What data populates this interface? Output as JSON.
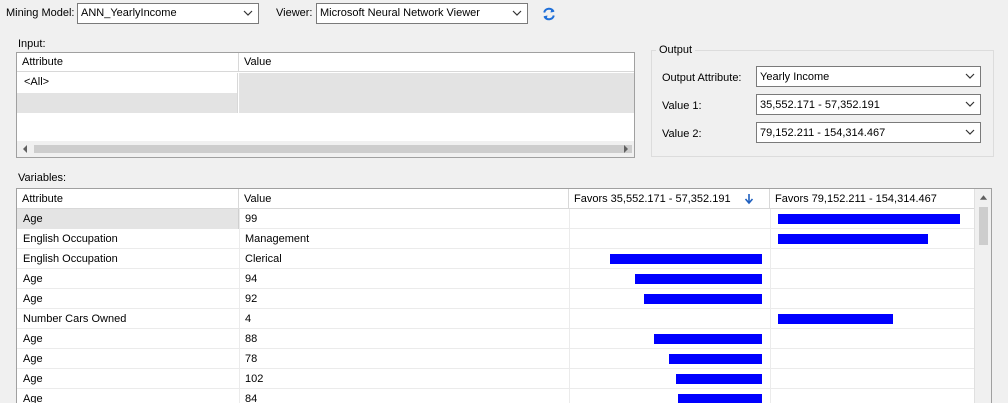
{
  "toolbar": {
    "mining_model_label": "Mining Model:",
    "mining_model_value": "ANN_YearlyIncome",
    "viewer_label": "Viewer:",
    "viewer_value": "Microsoft Neural Network Viewer",
    "refresh_icon": "refresh-icon"
  },
  "input": {
    "group_label": "Input:",
    "columns": [
      "Attribute",
      "Value"
    ],
    "rows": [
      {
        "attribute": "<All>",
        "value": ""
      },
      {
        "attribute": "",
        "value": ""
      }
    ]
  },
  "output": {
    "group_label": "Output",
    "output_attribute_label": "Output Attribute:",
    "output_attribute_value": "Yearly Income",
    "value1_label": "Value 1:",
    "value1_value": "35,552.171 - 57,352.191",
    "value2_label": "Value 2:",
    "value2_value": "79,152.211 - 154,314.467"
  },
  "variables": {
    "group_label": "Variables:",
    "columns": [
      "Attribute",
      "Value",
      "Favors 35,552.171 - 57,352.191",
      "Favors 79,152.211 - 154,314.467"
    ],
    "sort_icon": "sort-down-arrow-icon",
    "bar_color": "#0000ff",
    "rows": [
      {
        "attribute": "Age",
        "value": "99",
        "favors1": 0,
        "favors2": 0.97
      },
      {
        "attribute": "English Occupation",
        "value": "Management",
        "favors1": 0,
        "favors2": 0.8
      },
      {
        "attribute": "English Occupation",
        "value": "Clerical",
        "favors1": 0.8,
        "favors2": 0
      },
      {
        "attribute": "Age",
        "value": "94",
        "favors1": 0.67,
        "favors2": 0
      },
      {
        "attribute": "Age",
        "value": "92",
        "favors1": 0.62,
        "favors2": 0
      },
      {
        "attribute": "Number Cars Owned",
        "value": "4",
        "favors1": 0,
        "favors2": 0.61
      },
      {
        "attribute": "Age",
        "value": "88",
        "favors1": 0.57,
        "favors2": 0
      },
      {
        "attribute": "Age",
        "value": "78",
        "favors1": 0.49,
        "favors2": 0
      },
      {
        "attribute": "Age",
        "value": "102",
        "favors1": 0.45,
        "favors2": 0
      },
      {
        "attribute": "Age",
        "value": "84",
        "favors1": 0.44,
        "favors2": 0
      }
    ]
  }
}
